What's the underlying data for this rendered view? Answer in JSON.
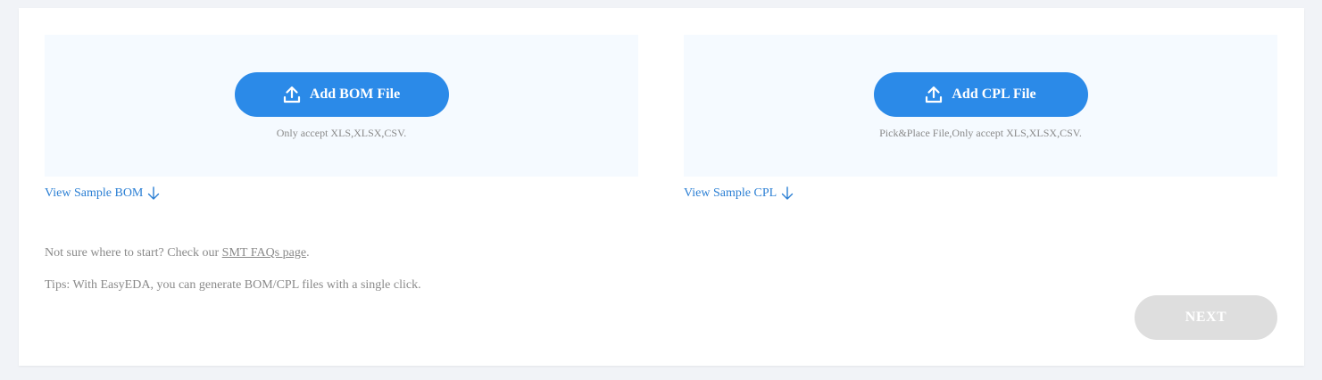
{
  "bom": {
    "button_label": "Add BOM File",
    "icon": "upload-icon",
    "hint": "Only accept XLS,XLSX,CSV.",
    "sample_link": "View Sample BOM"
  },
  "cpl": {
    "button_label": "Add CPL File",
    "icon": "upload-icon",
    "hint": "Pick&Place File,Only accept XLS,XLSX,CSV.",
    "sample_link": "View Sample CPL"
  },
  "info": {
    "faq_prefix": "Not sure where to start? Check our ",
    "faq_link": "SMT FAQs page",
    "faq_suffix": ".",
    "tips": "Tips: With EasyEDA, you can generate BOM/CPL files with a single click."
  },
  "next": {
    "label": "NEXT",
    "disabled": true
  },
  "colors": {
    "primary": "#2b8ae8",
    "link": "#2b7fd4",
    "dropzone_bg": "#f5faff",
    "disabled_button": "#dedede",
    "page_bg": "#f1f3f7"
  }
}
